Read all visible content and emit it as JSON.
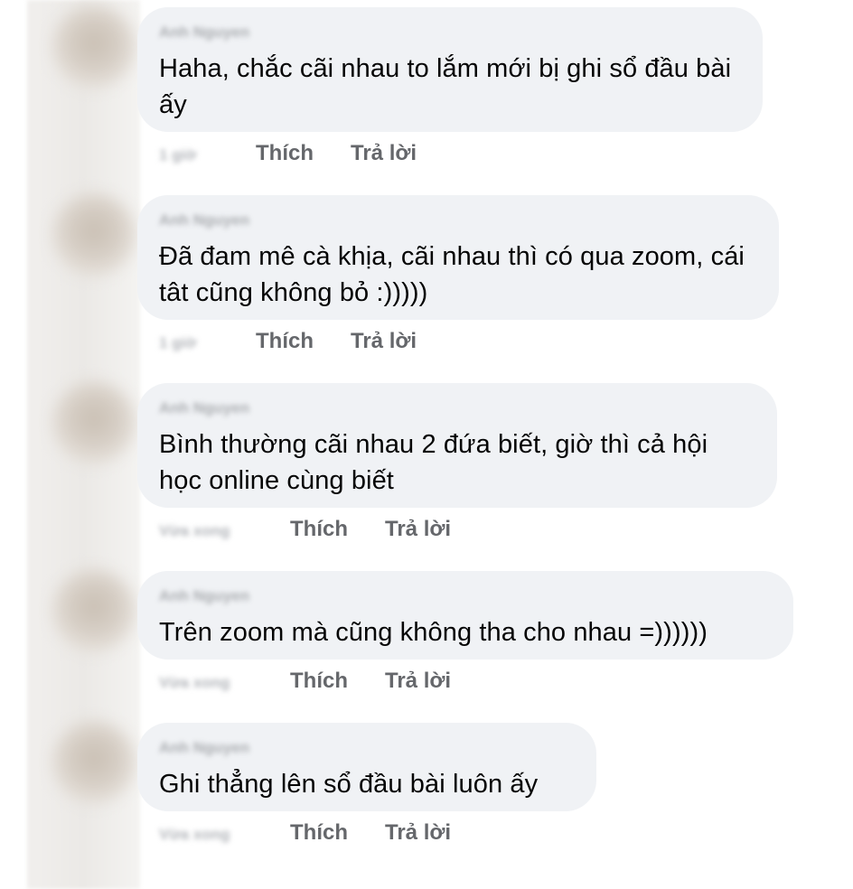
{
  "comments": [
    {
      "author": "Anh Nguyen",
      "text": "Haha, chắc cãi nhau to lắm mới bị ghi sổ đầu bài ấy",
      "time": "1 giờ",
      "like_label": "Thích",
      "reply_label": "Trả lời"
    },
    {
      "author": "Anh Nguyen",
      "text": "Đã đam mê cà khịa, cãi nhau thì có qua zoom, cái tât cũng không bỏ :)))))",
      "time": "1 giờ",
      "like_label": "Thích",
      "reply_label": "Trả lời"
    },
    {
      "author": "Anh Nguyen",
      "text": "Bình thường cãi nhau 2 đứa biết, giờ thì cả hội học online cùng biết",
      "time": "Vừa xong",
      "like_label": "Thích",
      "reply_label": "Trả lời"
    },
    {
      "author": "Anh Nguyen",
      "text": "Trên zoom mà cũng không tha cho nhau =))))))",
      "time": "Vừa xong",
      "like_label": "Thích",
      "reply_label": "Trả lời"
    },
    {
      "author": "Anh Nguyen",
      "text": "Ghi thẳng lên sổ đầu bài luôn ấy",
      "time": "Vừa xong",
      "like_label": "Thích",
      "reply_label": "Trả lời"
    }
  ]
}
